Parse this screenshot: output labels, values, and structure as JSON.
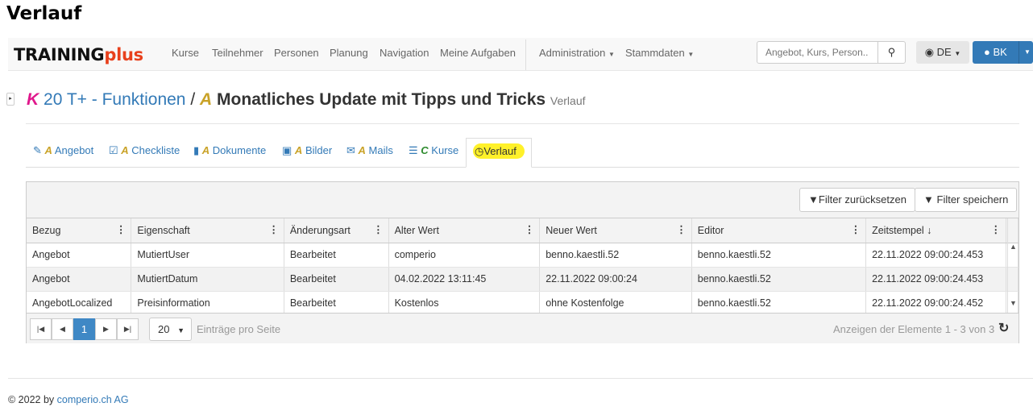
{
  "page_title": "Verlauf",
  "navbar": {
    "brand_main": "TRAINING",
    "brand_accent": "plus",
    "links": [
      "Kurse",
      "Teilnehmer",
      "Personen",
      "Planung",
      "Navigation",
      "Meine Aufgaben"
    ],
    "dropdowns": [
      "Administration",
      "Stammdaten"
    ],
    "search_placeholder": "Angebot, Kurs, Person..",
    "language": "DE",
    "user": "BK"
  },
  "heading": {
    "k_letter": "K",
    "course": "20 T+ - Funktionen",
    "slash": "/",
    "a_letter": "A",
    "offer": "Monatliches Update mit Tipps und Tricks",
    "sub": "Verlauf"
  },
  "tabs": [
    {
      "prefix": "A",
      "label": "Angebot"
    },
    {
      "prefix": "A",
      "label": "Checkliste"
    },
    {
      "prefix": "A",
      "label": "Dokumente"
    },
    {
      "prefix": "A",
      "label": "Bilder"
    },
    {
      "prefix": "A",
      "label": "Mails"
    },
    {
      "prefix": "C",
      "label": "Kurse"
    },
    {
      "prefix": "",
      "label": "Verlauf"
    }
  ],
  "toolbar": {
    "reset": "Filter zurücksetzen",
    "save": "Filter speichern"
  },
  "columns": [
    "Bezug",
    "Eigenschaft",
    "Änderungsart",
    "Alter Wert",
    "Neuer Wert",
    "Editor",
    "Zeitstempel"
  ],
  "rows": [
    [
      "Angebot",
      "MutiertUser",
      "Bearbeitet",
      "comperio",
      "benno.kaestli.52",
      "benno.kaestli.52",
      "22.11.2022 09:00:24.453"
    ],
    [
      "Angebot",
      "MutiertDatum",
      "Bearbeitet",
      "04.02.2022 13:11:45",
      "22.11.2022 09:00:24",
      "benno.kaestli.52",
      "22.11.2022 09:00:24.453"
    ],
    [
      "AngebotLocalized",
      "Preisinformation",
      "Bearbeitet",
      "Kostenlos",
      "ohne Kostenfolge",
      "benno.kaestli.52",
      "22.11.2022 09:00:24.452"
    ]
  ],
  "pager": {
    "current_page": "1",
    "page_size": "20",
    "page_size_label": "Einträge pro Seite",
    "info": "Anzeigen der Elemente 1 - 3 von 3"
  },
  "footer": {
    "text": "© 2022 by",
    "link": "comperio.ch AG"
  }
}
